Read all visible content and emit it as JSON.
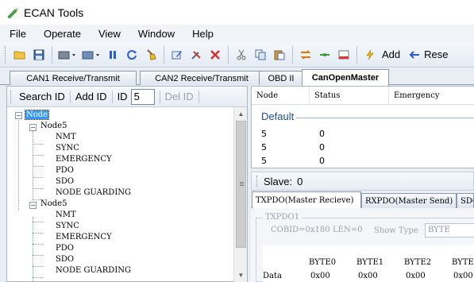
{
  "window": {
    "title": "ECAN Tools"
  },
  "menu": [
    "File",
    "Operate",
    "View",
    "Window",
    "Help"
  ],
  "toolbar": {
    "add_label": "Add",
    "reset_label": "Rese"
  },
  "tabs": [
    "CAN1 Receive/Transmit",
    "CAN2 Receive/Transmit",
    "OBD II",
    "CanOpenMaster"
  ],
  "left_toolbar": {
    "search": "Search ID",
    "add": "Add ID",
    "id_label": "ID",
    "id_value": "5",
    "del": "Del ID"
  },
  "tree": {
    "root": "Node",
    "groups": [
      {
        "label": "Node5",
        "children": [
          "NMT",
          "SYNC",
          "EMERGENCY",
          "PDO",
          "SDO",
          "NODE GUARDING"
        ]
      },
      {
        "label": "Node5",
        "children": [
          "NMT",
          "SYNC",
          "EMERGENCY",
          "PDO",
          "SDO",
          "NODE GUARDING"
        ]
      }
    ]
  },
  "grid": {
    "columns": [
      "Node",
      "Status",
      "Emergency"
    ],
    "group": "Default",
    "rows": [
      [
        "5",
        "0"
      ],
      [
        "5",
        "0"
      ],
      [
        "5",
        "0"
      ]
    ]
  },
  "slave": {
    "label": "Slave:",
    "value": "0"
  },
  "subtabs": [
    "TXPDO(Master Recieve)",
    "RXPDO(Master Send)",
    "SDO"
  ],
  "txpdo": {
    "group_title": "TXPDO1",
    "cobid": "COBID=0x180",
    "len": "LEN=0",
    "show_type_label": "Show Type",
    "show_type_value": "BYTE",
    "headers": [
      "BYTE0",
      "BYTE1",
      "BYTE2",
      "BYTE"
    ],
    "row_label": "Data",
    "values": [
      "0x00",
      "0x00",
      "0x00",
      "0x00"
    ]
  }
}
